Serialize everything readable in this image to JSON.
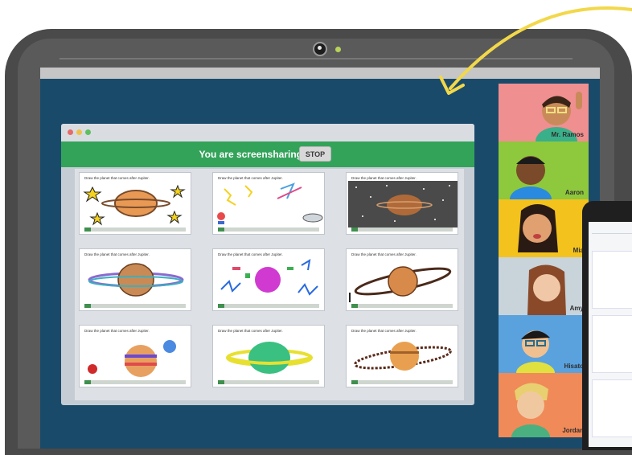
{
  "banner": {
    "text": "You are screensharing",
    "stop_label": "STOP"
  },
  "slide_prompt": "Draw the planet that comes after Jupiter.",
  "participants": [
    {
      "name": "Mr. Ramos",
      "bg": "#f08f8f"
    },
    {
      "name": "Aaron",
      "bg": "#8ec83c"
    },
    {
      "name": "Mia",
      "bg": "#f3c21d"
    },
    {
      "name": "Amy",
      "bg": "#c8d3da"
    },
    {
      "name": "Hisato",
      "bg": "#5aa2de"
    },
    {
      "name": "Jordan",
      "bg": "#f08a58"
    }
  ],
  "colors": {
    "screen": "#1a4a6a",
    "banner": "#33a35a",
    "arrow": "#f2d84a"
  },
  "icons": {
    "arrow": "curved-arrow-icon",
    "camera": "camera-icon"
  }
}
